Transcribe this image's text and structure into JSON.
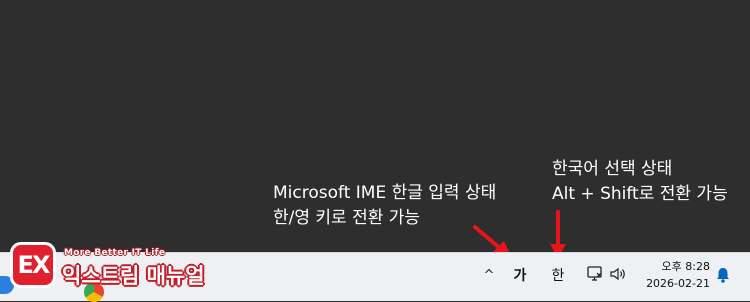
{
  "annotations": {
    "ime_note": {
      "line1": "Microsoft IME 한글 입력 상태",
      "line2": "한/영 키로 전환 가능"
    },
    "korean_note": {
      "line1": "한국어 선택 상태",
      "line2": "Alt + Shift로 전환 가능"
    }
  },
  "logo": {
    "badge": "EX",
    "subtitle": "More Better IT Life",
    "title": "익스트림 매뉴얼"
  },
  "tray": {
    "chevron": "^",
    "ime_mode": "가",
    "language": "한",
    "icons": [
      "network-icon",
      "volume-icon",
      "notification-bell-icon"
    ]
  },
  "clock": {
    "time": "오후 8:28",
    "date": "2026-02-21"
  },
  "colors": {
    "desktop": "#2e2e2e",
    "taskbar": "#eef0f3",
    "arrow": "#e8141c",
    "accent": "#0067c0"
  }
}
